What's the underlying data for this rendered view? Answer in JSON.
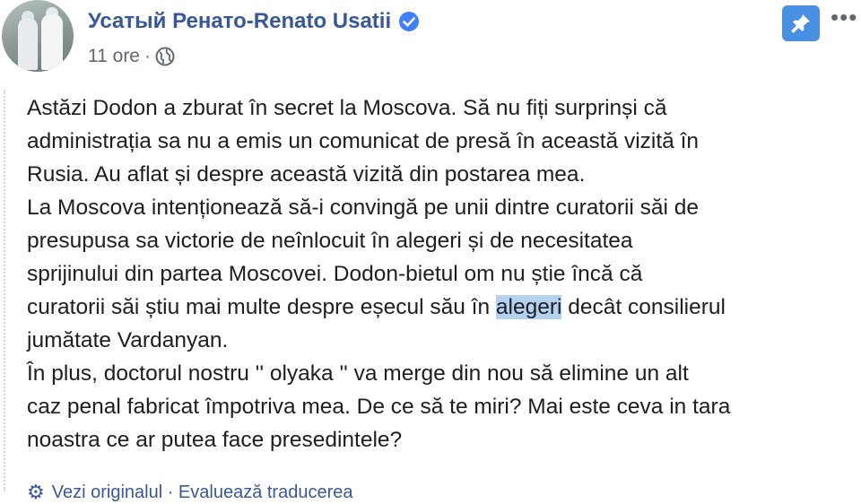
{
  "post_header": {
    "author_name": "Усатый Ренато-Renato Usatii",
    "timestamp": "11 ore",
    "separator": "·",
    "audience_icon": "globe-icon",
    "verified_icon": "verified-badge-icon",
    "pin_icon": "pin-icon",
    "more_icon": "more-options-icon",
    "more_glyph": "•••"
  },
  "post_body": {
    "lines": [
      "Astăzi Dodon a zburat în secret la Moscova. Să nu fiți surprinși că",
      "administrația sa nu a emis un comunicat de presă în această vizită în",
      "Rusia. Au aflat și despre această vizită din postarea mea.",
      "La Moscova intenționează să-i convingă pe unii dintre curatorii săi de",
      "presupusa sa victorie de neînlocuit în alegeri și de necesitatea",
      "sprijinului din partea Moscovei. Dodon-bietul om nu știe încă că",
      "curatorii săi știu mai multe despre eșecul său în ",
      "alegeri",
      " decât consilierul",
      "jumătate Vardanyan.",
      "În plus, doctorul nostru '' olyaka '' va merge din nou să elimine un alt",
      "caz penal fabricat împotriva mea. De ce să te miri? Mai este ceva in tara",
      "noastra ce ar putea face presedintele?"
    ],
    "highlighted_word": "alegeri"
  },
  "footer": {
    "translation_icon": "gear-icon",
    "translation_link": "Vezi originalul · Evaluează traducerea"
  },
  "colors": {
    "author_link": "#385898",
    "meta_text": "#606770",
    "body_text": "#1c1e21",
    "pin_button": "#4a90e2",
    "verified_badge": "#4080ff",
    "highlight": "#b4d2f0"
  }
}
